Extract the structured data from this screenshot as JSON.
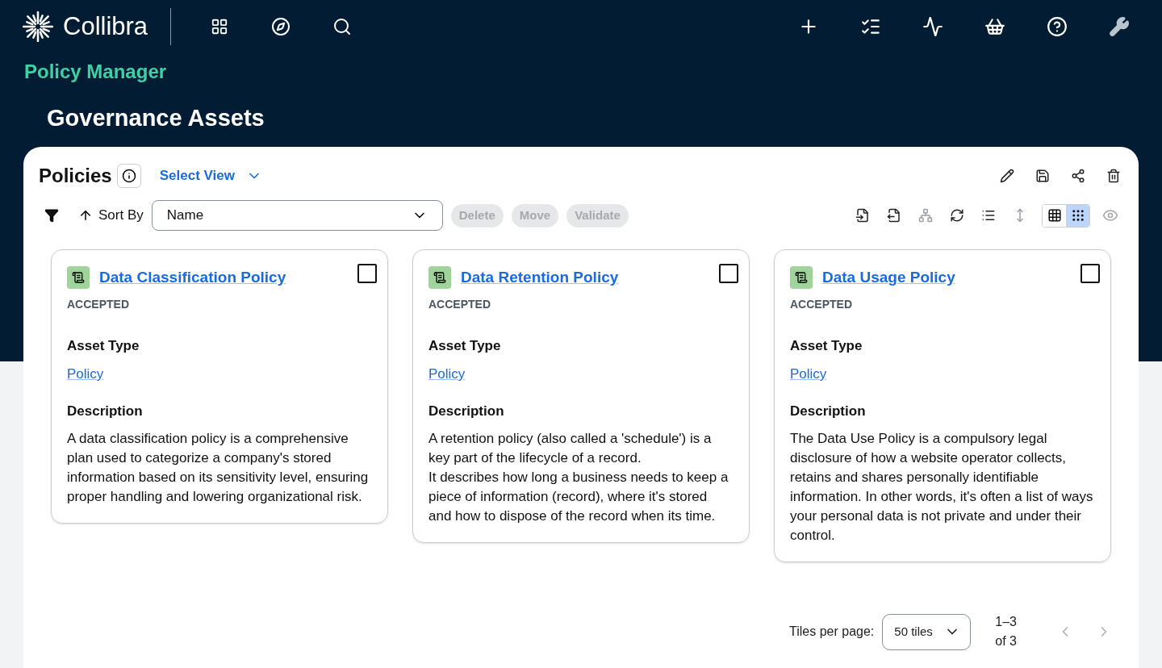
{
  "app": {
    "brand": "Collibra",
    "section": "Policy Manager"
  },
  "page_title": "Governance Assets",
  "panel": {
    "title": "Policies",
    "view_selector": "Select View",
    "sort": {
      "label": "Sort By",
      "value": "Name"
    },
    "actions": [
      {
        "label": "Delete",
        "disabled": true
      },
      {
        "label": "Move",
        "disabled": true
      },
      {
        "label": "Validate",
        "disabled": true
      }
    ],
    "tools": [
      {
        "kind": "import",
        "disabled": false
      },
      {
        "kind": "export",
        "disabled": false
      },
      {
        "kind": "hierarchy",
        "disabled": true
      },
      {
        "kind": "sync",
        "disabled": false
      },
      {
        "kind": "list",
        "disabled": false
      },
      {
        "kind": "height",
        "disabled": true
      }
    ],
    "view_modes": [
      {
        "kind": "table",
        "selected": false
      },
      {
        "kind": "tiles",
        "selected": true
      }
    ],
    "tiles": [
      {
        "title": "Data Classification Policy",
        "status": "ACCEPTED",
        "checked": false,
        "type_label": "Asset Type",
        "type": "Policy",
        "description_label": "Description",
        "description": "A data classification policy is a comprehensive plan used to categorize a company's stored information based on its sensitivity level, ensuring proper handling and lowering organizational risk."
      },
      {
        "title": "Data Retention Policy",
        "status": "ACCEPTED",
        "checked": false,
        "type_label": "Asset Type",
        "type": "Policy",
        "description_label": "Description",
        "description": "A retention policy (also called a 'schedule') is a key part of the lifecycle of a record.\nIt describes how long a business needs to keep a piece of information (record), where it's stored and how to dispose of the record when its time."
      },
      {
        "title": "Data Usage Policy",
        "status": "ACCEPTED",
        "checked": false,
        "type_label": "Asset Type",
        "type": "Policy",
        "description_label": "Description",
        "description": "The Data Use Policy is a compulsory legal disclosure of how a website operator collects, retains and shares personally identifiable information. In other words, it's often a list of ways your personal data is not private and under their control."
      }
    ],
    "pagination": {
      "label": "Tiles per page:",
      "per_page": "50 tiles",
      "range": "1–3",
      "total": "of 3",
      "prev_disabled": true,
      "next_disabled": true
    }
  }
}
